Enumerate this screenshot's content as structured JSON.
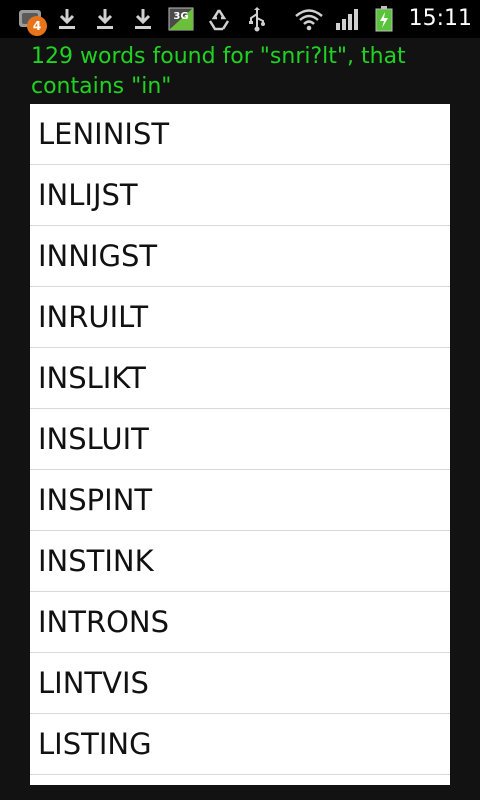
{
  "status_bar": {
    "notification_count": "4",
    "network_type": "3G",
    "time": "15:11"
  },
  "header": {
    "summary": "129 words found for \"snri?lt\", that contains \"in\""
  },
  "word_list": [
    "LENINIST",
    "INLIJST",
    "INNIGST",
    "INRUILT",
    "INSLIKT",
    "INSLUIT",
    "INSPINT",
    "INSTINK",
    "INTRONS",
    "LINTVIS",
    "LISTING"
  ],
  "colors": {
    "header_text": "#21d321",
    "list_background": "#ffffff",
    "background": "#121212",
    "badge": "#e8741a"
  }
}
